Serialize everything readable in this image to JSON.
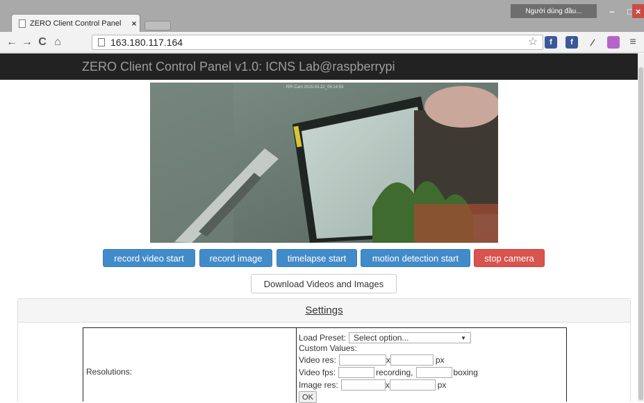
{
  "browser": {
    "tab_title": "ZERO Client Control Panel",
    "tab_close": "×",
    "user_label": "Người dùng đầu...",
    "url": "163.180.117.164",
    "nav": {
      "back": "←",
      "forward": "→",
      "reload": "C",
      "home": "⌂"
    },
    "window_controls": {
      "minimize": "–",
      "maximize": "□",
      "close": "×"
    },
    "star": "☆"
  },
  "page": {
    "brand": "ZERO Client Control Panel v1.0: ICNS Lab@raspberrypi",
    "camera_overlay": "RPi Cam 2015.03.22_06:14:53",
    "buttons": {
      "record_video": "record video start",
      "record_image": "record image",
      "timelapse": "timelapse start",
      "motion_detection": "motion detection start",
      "stop_camera": "stop camera",
      "download": "Download Videos and Images"
    },
    "settings": {
      "heading": "Settings",
      "resolutions_label": "Resolutions:",
      "load_preset_label": "Load Preset:",
      "preset_selected": "Select option...",
      "custom_values_label": "Custom Values:",
      "video_res_label": "Video res:",
      "x_sep": "x",
      "px_unit": "px",
      "video_fps_label": "Video fps:",
      "recording_label": "recording,",
      "boxing_label": "boxing",
      "image_res_label": "Image res:",
      "ok_label": "OK"
    }
  }
}
